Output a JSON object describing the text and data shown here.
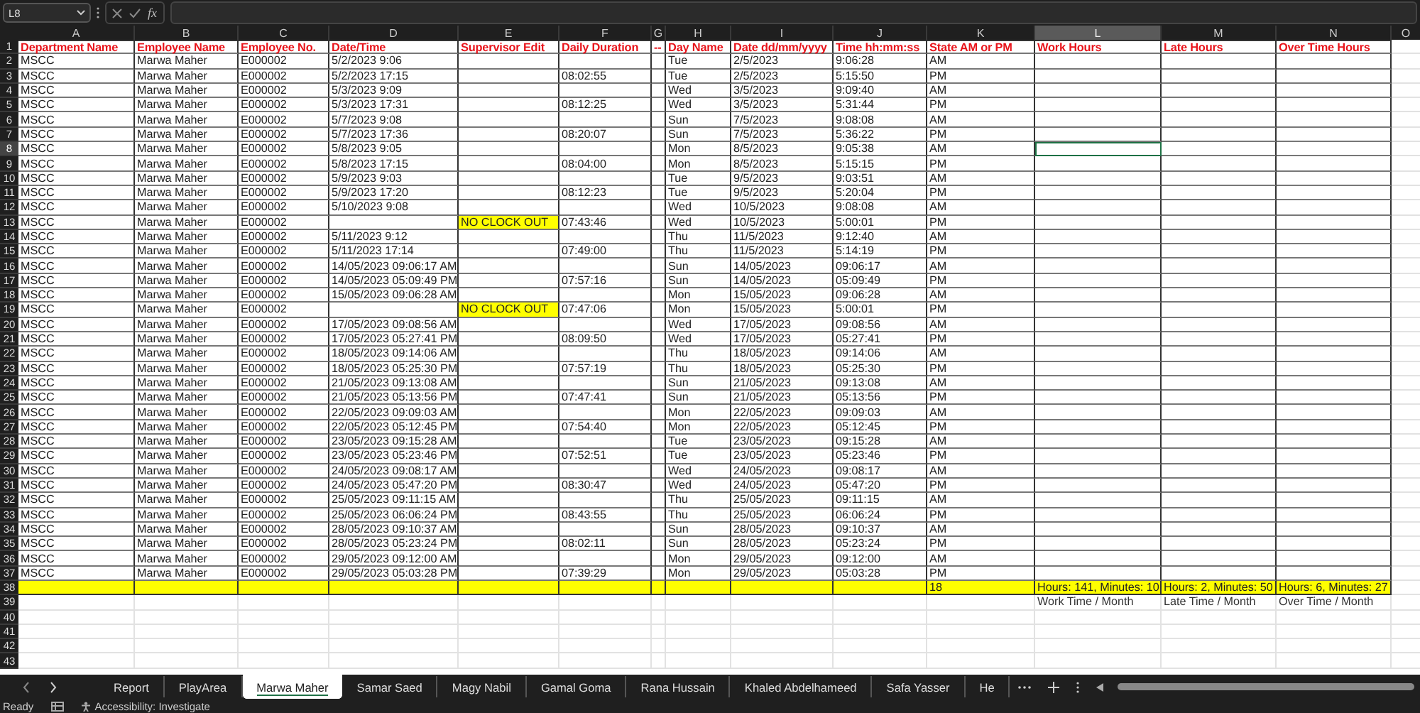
{
  "formula_bar": {
    "name_box": "L8",
    "function_label": "fx"
  },
  "columns": [
    {
      "letter": "A",
      "selected": false
    },
    {
      "letter": "B",
      "selected": false
    },
    {
      "letter": "C",
      "selected": false
    },
    {
      "letter": "D",
      "selected": false
    },
    {
      "letter": "E",
      "selected": false
    },
    {
      "letter": "F",
      "selected": false
    },
    {
      "letter": "G",
      "selected": false
    },
    {
      "letter": "H",
      "selected": false
    },
    {
      "letter": "I",
      "selected": false
    },
    {
      "letter": "J",
      "selected": false
    },
    {
      "letter": "K",
      "selected": false
    },
    {
      "letter": "L",
      "selected": true
    },
    {
      "letter": "M",
      "selected": false
    },
    {
      "letter": "N",
      "selected": false
    },
    {
      "letter": "O",
      "selected": false
    }
  ],
  "rows": [
    {
      "number": "1",
      "kind": "header",
      "selected": false,
      "cells": {
        "A": "Department Name",
        "B": "Employee Name",
        "C": "Employee No.",
        "D": "Date/Time",
        "E": "Supervisor Edit",
        "F": "Daily Duration",
        "G": "--",
        "H": "Day Name",
        "I": "Date dd/mm/yyyy",
        "J": "Time hh:mm:ss",
        "K": "State AM or PM",
        "L": "Work Hours",
        "M": "Late Hours",
        "N": "Over Time Hours"
      }
    },
    {
      "number": "2",
      "kind": "data",
      "selected": false,
      "cells": {
        "A": "MSCC",
        "B": "Marwa Maher",
        "C": "E000002",
        "D": "5/2/2023 9:06",
        "H": "Tue",
        "I": "2/5/2023",
        "J": "9:06:28",
        "K": "AM"
      }
    },
    {
      "number": "3",
      "kind": "data",
      "selected": false,
      "cells": {
        "A": "MSCC",
        "B": "Marwa Maher",
        "C": "E000002",
        "D": "5/2/2023 17:15",
        "F": "08:02:55",
        "H": "Tue",
        "I": "2/5/2023",
        "J": "5:15:50",
        "K": "PM"
      }
    },
    {
      "number": "4",
      "kind": "data",
      "selected": false,
      "cells": {
        "A": "MSCC",
        "B": "Marwa Maher",
        "C": "E000002",
        "D": "5/3/2023 9:09",
        "H": "Wed",
        "I": "3/5/2023",
        "J": "9:09:40",
        "K": "AM"
      }
    },
    {
      "number": "5",
      "kind": "data",
      "selected": false,
      "cells": {
        "A": "MSCC",
        "B": "Marwa Maher",
        "C": "E000002",
        "D": "5/3/2023 17:31",
        "F": "08:12:25",
        "H": "Wed",
        "I": "3/5/2023",
        "J": "5:31:44",
        "K": "PM"
      }
    },
    {
      "number": "6",
      "kind": "data",
      "selected": false,
      "cells": {
        "A": "MSCC",
        "B": "Marwa Maher",
        "C": "E000002",
        "D": "5/7/2023 9:08",
        "H": "Sun",
        "I": "7/5/2023",
        "J": "9:08:08",
        "K": "AM"
      }
    },
    {
      "number": "7",
      "kind": "data",
      "selected": false,
      "cells": {
        "A": "MSCC",
        "B": "Marwa Maher",
        "C": "E000002",
        "D": "5/7/2023 17:36",
        "F": "08:20:07",
        "H": "Sun",
        "I": "7/5/2023",
        "J": "5:36:22",
        "K": "PM"
      }
    },
    {
      "number": "8",
      "kind": "data",
      "selected": true,
      "cells": {
        "A": "MSCC",
        "B": "Marwa Maher",
        "C": "E000002",
        "D": "5/8/2023 9:05",
        "H": "Mon",
        "I": "8/5/2023",
        "J": "9:05:38",
        "K": "AM"
      }
    },
    {
      "number": "9",
      "kind": "data",
      "selected": false,
      "cells": {
        "A": "MSCC",
        "B": "Marwa Maher",
        "C": "E000002",
        "D": "5/8/2023 17:15",
        "F": "08:04:00",
        "H": "Mon",
        "I": "8/5/2023",
        "J": "5:15:15",
        "K": "PM"
      }
    },
    {
      "number": "10",
      "kind": "data",
      "selected": false,
      "cells": {
        "A": "MSCC",
        "B": "Marwa Maher",
        "C": "E000002",
        "D": "5/9/2023 9:03",
        "H": "Tue",
        "I": "9/5/2023",
        "J": "9:03:51",
        "K": "AM"
      }
    },
    {
      "number": "11",
      "kind": "data",
      "selected": false,
      "cells": {
        "A": "MSCC",
        "B": "Marwa Maher",
        "C": "E000002",
        "D": "5/9/2023 17:20",
        "F": "08:12:23",
        "H": "Tue",
        "I": "9/5/2023",
        "J": "5:20:04",
        "K": "PM"
      }
    },
    {
      "number": "12",
      "kind": "data",
      "selected": false,
      "cells": {
        "A": "MSCC",
        "B": "Marwa Maher",
        "C": "E000002",
        "D": "5/10/2023 9:08",
        "H": "Wed",
        "I": "10/5/2023",
        "J": "9:08:08",
        "K": "AM"
      }
    },
    {
      "number": "13",
      "kind": "data",
      "selected": false,
      "cells": {
        "A": "MSCC",
        "B": "Marwa Maher",
        "C": "E000002",
        "E": {
          "text": "NO CLOCK OUT",
          "highlighted": true
        },
        "F": "07:43:46",
        "H": "Wed",
        "I": "10/5/2023",
        "J": "5:00:01",
        "K": "PM"
      }
    },
    {
      "number": "14",
      "kind": "data",
      "selected": false,
      "cells": {
        "A": "MSCC",
        "B": "Marwa Maher",
        "C": "E000002",
        "D": "5/11/2023 9:12",
        "H": "Thu",
        "I": "11/5/2023",
        "J": "9:12:40",
        "K": "AM"
      }
    },
    {
      "number": "15",
      "kind": "data",
      "selected": false,
      "cells": {
        "A": "MSCC",
        "B": "Marwa Maher",
        "C": "E000002",
        "D": "5/11/2023 17:14",
        "F": "07:49:00",
        "H": "Thu",
        "I": "11/5/2023",
        "J": "5:14:19",
        "K": "PM"
      }
    },
    {
      "number": "16",
      "kind": "data",
      "selected": false,
      "cells": {
        "A": "MSCC",
        "B": "Marwa Maher",
        "C": "E000002",
        "D": "14/05/2023 09:06:17 AM",
        "H": "Sun",
        "I": "14/05/2023",
        "J": "09:06:17",
        "K": "AM"
      }
    },
    {
      "number": "17",
      "kind": "data",
      "selected": false,
      "cells": {
        "A": "MSCC",
        "B": "Marwa Maher",
        "C": "E000002",
        "D": "14/05/2023 05:09:49 PM",
        "F": "07:57:16",
        "H": "Sun",
        "I": "14/05/2023",
        "J": "05:09:49",
        "K": "PM"
      }
    },
    {
      "number": "18",
      "kind": "data",
      "selected": false,
      "cells": {
        "A": "MSCC",
        "B": "Marwa Maher",
        "C": "E000002",
        "D": "15/05/2023 09:06:28 AM",
        "H": "Mon",
        "I": "15/05/2023",
        "J": "09:06:28",
        "K": "AM"
      }
    },
    {
      "number": "19",
      "kind": "data",
      "selected": false,
      "cells": {
        "A": "MSCC",
        "B": "Marwa Maher",
        "C": "E000002",
        "E": {
          "text": "NO CLOCK OUT",
          "highlighted": true
        },
        "F": "07:47:06",
        "H": "Mon",
        "I": "15/05/2023",
        "J": "5:00:01",
        "K": "PM"
      }
    },
    {
      "number": "20",
      "kind": "data",
      "selected": false,
      "cells": {
        "A": "MSCC",
        "B": "Marwa Maher",
        "C": "E000002",
        "D": "17/05/2023 09:08:56 AM",
        "H": "Wed",
        "I": "17/05/2023",
        "J": "09:08:56",
        "K": "AM"
      }
    },
    {
      "number": "21",
      "kind": "data",
      "selected": false,
      "cells": {
        "A": "MSCC",
        "B": "Marwa Maher",
        "C": "E000002",
        "D": "17/05/2023 05:27:41 PM",
        "F": "08:09:50",
        "H": "Wed",
        "I": "17/05/2023",
        "J": "05:27:41",
        "K": "PM"
      }
    },
    {
      "number": "22",
      "kind": "data",
      "selected": false,
      "cells": {
        "A": "MSCC",
        "B": "Marwa Maher",
        "C": "E000002",
        "D": "18/05/2023 09:14:06 AM",
        "H": "Thu",
        "I": "18/05/2023",
        "J": "09:14:06",
        "K": "AM"
      }
    },
    {
      "number": "23",
      "kind": "data",
      "selected": false,
      "cells": {
        "A": "MSCC",
        "B": "Marwa Maher",
        "C": "E000002",
        "D": "18/05/2023 05:25:30 PM",
        "F": "07:57:19",
        "H": "Thu",
        "I": "18/05/2023",
        "J": "05:25:30",
        "K": "PM"
      }
    },
    {
      "number": "24",
      "kind": "data",
      "selected": false,
      "cells": {
        "A": "MSCC",
        "B": "Marwa Maher",
        "C": "E000002",
        "D": "21/05/2023 09:13:08 AM",
        "H": "Sun",
        "I": "21/05/2023",
        "J": "09:13:08",
        "K": "AM"
      }
    },
    {
      "number": "25",
      "kind": "data",
      "selected": false,
      "cells": {
        "A": "MSCC",
        "B": "Marwa Maher",
        "C": "E000002",
        "D": "21/05/2023 05:13:56 PM",
        "F": "07:47:41",
        "H": "Sun",
        "I": "21/05/2023",
        "J": "05:13:56",
        "K": "PM"
      }
    },
    {
      "number": "26",
      "kind": "data",
      "selected": false,
      "cells": {
        "A": "MSCC",
        "B": "Marwa Maher",
        "C": "E000002",
        "D": "22/05/2023 09:09:03 AM",
        "H": "Mon",
        "I": "22/05/2023",
        "J": "09:09:03",
        "K": "AM"
      }
    },
    {
      "number": "27",
      "kind": "data",
      "selected": false,
      "cells": {
        "A": "MSCC",
        "B": "Marwa Maher",
        "C": "E000002",
        "D": "22/05/2023 05:12:45 PM",
        "F": "07:54:40",
        "H": "Mon",
        "I": "22/05/2023",
        "J": "05:12:45",
        "K": "PM"
      }
    },
    {
      "number": "28",
      "kind": "data",
      "selected": false,
      "cells": {
        "A": "MSCC",
        "B": "Marwa Maher",
        "C": "E000002",
        "D": "23/05/2023 09:15:28 AM",
        "H": "Tue",
        "I": "23/05/2023",
        "J": "09:15:28",
        "K": "AM"
      }
    },
    {
      "number": "29",
      "kind": "data",
      "selected": false,
      "cells": {
        "A": "MSCC",
        "B": "Marwa Maher",
        "C": "E000002",
        "D": "23/05/2023 05:23:46 PM",
        "F": "07:52:51",
        "H": "Tue",
        "I": "23/05/2023",
        "J": "05:23:46",
        "K": "PM"
      }
    },
    {
      "number": "30",
      "kind": "data",
      "selected": false,
      "cells": {
        "A": "MSCC",
        "B": "Marwa Maher",
        "C": "E000002",
        "D": "24/05/2023 09:08:17 AM",
        "H": "Wed",
        "I": "24/05/2023",
        "J": "09:08:17",
        "K": "AM"
      }
    },
    {
      "number": "31",
      "kind": "data",
      "selected": false,
      "cells": {
        "A": "MSCC",
        "B": "Marwa Maher",
        "C": "E000002",
        "D": "24/05/2023 05:47:20 PM",
        "F": "08:30:47",
        "H": "Wed",
        "I": "24/05/2023",
        "J": "05:47:20",
        "K": "PM"
      }
    },
    {
      "number": "32",
      "kind": "data",
      "selected": false,
      "cells": {
        "A": "MSCC",
        "B": "Marwa Maher",
        "C": "E000002",
        "D": "25/05/2023 09:11:15 AM",
        "H": "Thu",
        "I": "25/05/2023",
        "J": "09:11:15",
        "K": "AM"
      }
    },
    {
      "number": "33",
      "kind": "data",
      "selected": false,
      "cells": {
        "A": "MSCC",
        "B": "Marwa Maher",
        "C": "E000002",
        "D": "25/05/2023 06:06:24 PM",
        "F": "08:43:55",
        "H": "Thu",
        "I": "25/05/2023",
        "J": "06:06:24",
        "K": "PM"
      }
    },
    {
      "number": "34",
      "kind": "data",
      "selected": false,
      "cells": {
        "A": "MSCC",
        "B": "Marwa Maher",
        "C": "E000002",
        "D": "28/05/2023 09:10:37 AM",
        "H": "Sun",
        "I": "28/05/2023",
        "J": "09:10:37",
        "K": "AM"
      }
    },
    {
      "number": "35",
      "kind": "data",
      "selected": false,
      "cells": {
        "A": "MSCC",
        "B": "Marwa Maher",
        "C": "E000002",
        "D": "28/05/2023 05:23:24 PM",
        "F": "08:02:11",
        "H": "Sun",
        "I": "28/05/2023",
        "J": "05:23:24",
        "K": "PM"
      }
    },
    {
      "number": "36",
      "kind": "data",
      "selected": false,
      "cells": {
        "A": "MSCC",
        "B": "Marwa Maher",
        "C": "E000002",
        "D": "29/05/2023 09:12:00 AM",
        "H": "Mon",
        "I": "29/05/2023",
        "J": "09:12:00",
        "K": "AM"
      }
    },
    {
      "number": "37",
      "kind": "data",
      "selected": false,
      "cells": {
        "A": "MSCC",
        "B": "Marwa Maher",
        "C": "E000002",
        "D": "29/05/2023 05:03:28 PM",
        "F": "07:39:29",
        "H": "Mon",
        "I": "29/05/2023",
        "J": "05:03:28",
        "K": "PM"
      }
    },
    {
      "number": "38",
      "kind": "total",
      "selected": false,
      "cells": {
        "K": "18",
        "L": "Hours: 141, Minutes: 10",
        "M": "Hours: 2, Minutes: 50",
        "N": "Hours: 6, Minutes: 27"
      }
    },
    {
      "number": "39",
      "kind": "note",
      "selected": false,
      "cells": {
        "L": "Work Time / Month",
        "M": "Late Time / Month",
        "N": "Over Time / Month"
      }
    },
    {
      "number": "40",
      "kind": "empty",
      "selected": false
    },
    {
      "number": "41",
      "kind": "empty",
      "selected": false
    },
    {
      "number": "42",
      "kind": "empty",
      "selected": false
    },
    {
      "number": "43",
      "kind": "empty",
      "selected": false
    }
  ],
  "sheet_tabs": [
    {
      "label": "Report",
      "selected": false
    },
    {
      "label": "PlayArea",
      "selected": false
    },
    {
      "label": "Marwa Maher",
      "selected": true
    },
    {
      "label": "Samar Saed",
      "selected": false
    },
    {
      "label": "Magy Nabil",
      "selected": false
    },
    {
      "label": "Gamal Goma",
      "selected": false
    },
    {
      "label": "Rana Hussain",
      "selected": false
    },
    {
      "label": "Khaled Abdelhameed",
      "selected": false
    },
    {
      "label": "Safa Yasser",
      "selected": false
    },
    {
      "label": "He",
      "selected": false
    }
  ],
  "status_bar": {
    "mode": "Ready",
    "accessibility": "Accessibility: Investigate"
  }
}
